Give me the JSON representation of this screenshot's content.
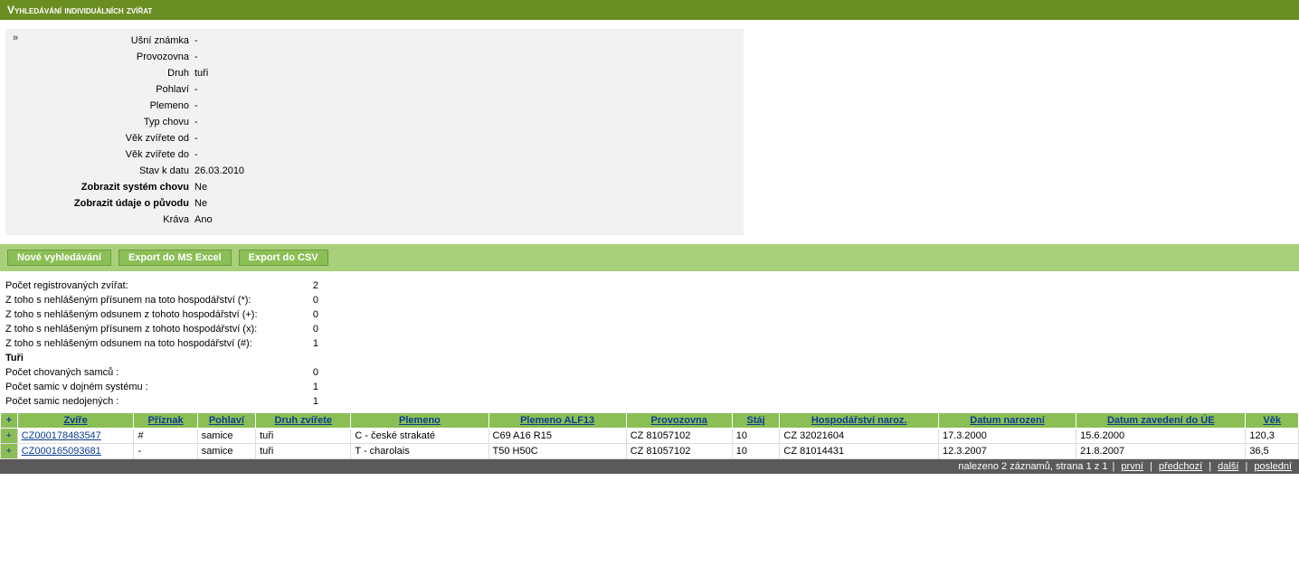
{
  "title": "Vyhledávání individuálních zvířat",
  "chevron": "»",
  "form": {
    "usni_znamka": {
      "label": "Ušní známka",
      "value": "-"
    },
    "provozovna": {
      "label": "Provozovna",
      "value": "-"
    },
    "druh": {
      "label": "Druh",
      "value": "tuři"
    },
    "pohlavi": {
      "label": "Pohlaví",
      "value": "-"
    },
    "plemeno": {
      "label": "Plemeno",
      "value": "-"
    },
    "typ_chovu": {
      "label": "Typ chovu",
      "value": "-"
    },
    "vek_od": {
      "label": "Věk zvířete od",
      "value": "-"
    },
    "vek_do": {
      "label": "Věk zvířete do",
      "value": "-"
    },
    "stav_k": {
      "label": "Stav k datu",
      "value": "26.03.2010"
    },
    "system": {
      "label": "Zobrazit systém chovu",
      "value": "Ne"
    },
    "puvod": {
      "label": "Zobrazit údaje o původu",
      "value": "Ne"
    },
    "krava": {
      "label": "Kráva",
      "value": "Ano"
    }
  },
  "buttons": {
    "search": "Nové vyhledávání",
    "excel": "Export do MS Excel",
    "csv": "Export do CSV"
  },
  "stats": {
    "registered": {
      "label": "Počet registrovaných zvířat:",
      "value": "2"
    },
    "star": {
      "label": "Z toho s nehlášeným přísunem na toto hospodářství (*):",
      "value": "0"
    },
    "plus": {
      "label": "Z toho s nehlášeným odsunem z tohoto hospodářství (+):",
      "value": "0"
    },
    "x": {
      "label": "Z toho s nehlášeným přísunem z tohoto hospodářství (x):",
      "value": "0"
    },
    "hash": {
      "label": "Z toho s nehlášeným odsunem na toto hospodářství (#):",
      "value": "1"
    },
    "turi_header": "Tuři",
    "males": {
      "label": "Počet chovaných samců :",
      "value": "0"
    },
    "milking": {
      "label": "Počet samic v dojném systému :",
      "value": "1"
    },
    "nonmilking": {
      "label": "Počet samic nedojených :",
      "value": "1"
    }
  },
  "table": {
    "corner": "+",
    "headers": [
      "Zvíře",
      "Příznak",
      "Pohlaví",
      "Druh zvířete",
      "Plemeno",
      "Plemeno ALF13",
      "Provozovna",
      "Stáj",
      "Hospodářství naroz.",
      "Datum narození",
      "Datum zavedení do ÚE",
      "Věk"
    ],
    "col_widths": [
      "110",
      "60",
      "55",
      "90",
      "130",
      "130",
      "100",
      "45",
      "150",
      "130",
      "160",
      "50"
    ],
    "rows": [
      [
        "CZ000178483547",
        "#",
        "samice",
        "tuři",
        "C - české strakaté",
        "C69 A16 R15",
        "CZ 81057102",
        "10",
        "CZ 32021604",
        "17.3.2000",
        "15.6.2000",
        "120,3"
      ],
      [
        "CZ000165093681",
        "-",
        "samice",
        "tuři",
        "T - charolais",
        "T50 H50C",
        "CZ 81057102",
        "10",
        "CZ 81014431",
        "12.3.2007",
        "21.8.2007",
        "36,5"
      ]
    ]
  },
  "pager": {
    "summary": "nalezeno 2 záznamů, strana 1 z 1",
    "first": "první",
    "prev": "předchozí",
    "next": "další",
    "last": "poslední"
  }
}
